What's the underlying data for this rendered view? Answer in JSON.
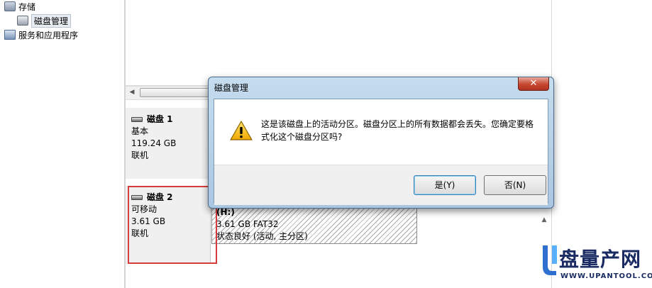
{
  "tree": {
    "storage": "存储",
    "disk_management": "磁盘管理",
    "services": "服务和应用程序"
  },
  "disks": [
    {
      "name": "磁盘 1",
      "type": "基本",
      "size": "119.24 GB",
      "status": "联机"
    },
    {
      "name": "磁盘 2",
      "type": "可移动",
      "size": "3.61 GB",
      "status": "联机"
    }
  ],
  "partition": {
    "letter": "(H:)",
    "size_fs": "3.61 GB FAT32",
    "health": "状态良好 (活动, 主分区)"
  },
  "dialog": {
    "title": "磁盘管理",
    "close": "✕",
    "message": "这是该磁盘上的活动分区。磁盘分区上的所有数据都会丢失。您确定要格式化这个磁盘分区吗?",
    "yes": "是(Y)",
    "no": "否(N)"
  },
  "watermark": {
    "brand": "盘量产网",
    "url": "WWW.UPANTOOL.COM"
  },
  "colors": {
    "highlight": "#d63c3c",
    "partition_header": "#244fa8"
  }
}
